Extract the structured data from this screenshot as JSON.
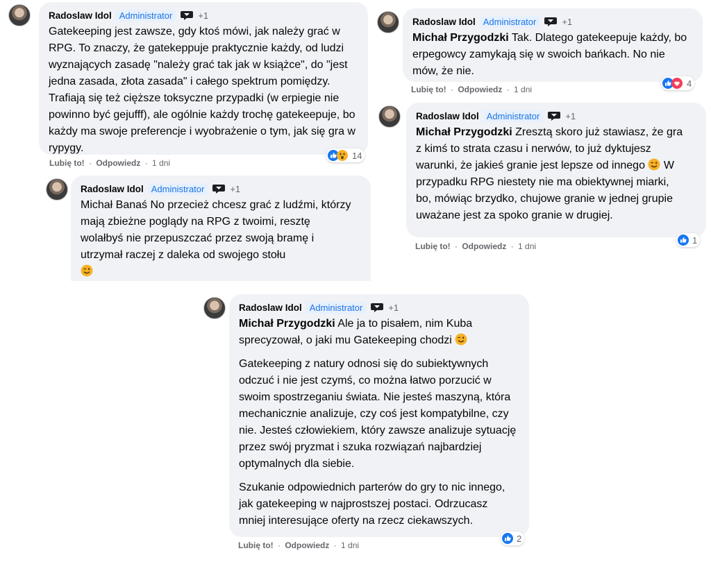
{
  "common": {
    "author": "Radoslaw Idol",
    "role": "Administrator",
    "plus": "+1",
    "like": "Lubię to!",
    "reply": "Odpowiedz",
    "dot": "·",
    "time": "1 dni"
  },
  "c1": {
    "text": "Gatekeeping jest zawsze, gdy ktoś mówi, jak należy grać w RPG. To znaczy, że gatekeppuje praktycznie każdy, od ludzi wyznających zasadę \"należy grać tak jak w książce\", do \"jest jedna zasada, złota zasada\" i całego spektrum pomiędzy. Trafiają się też cięższe toksyczne przypadki (w erpiegie nie powinno być gejufff), ale ogólnie każdy trochę gatekeepuje, bo każdy ma swoje preferencje i wyobrażenie o tym, jak się gra w rypygy.",
    "reaction_count": "14",
    "reactions": [
      "like-icon",
      "wow-icon"
    ]
  },
  "c2": {
    "text": "Michał Banaś No przecież chcesz grać z ludźmi, którzy mają zbieżne poglądy na RPG z twoimi, resztę wolałbyś nie przepuszczać przez swoją bramę i utrzymał raczej z daleka od swojego stołu"
  },
  "c3": {
    "mention": "Michał Przygodzki",
    "text": "Tak. Dlatego gatekeepuje każdy, bo erpegowcy zamykają się w swoich bańkach. No nie mów, że nie.",
    "reaction_count": "4",
    "reactions": [
      "like-icon",
      "love-icon"
    ]
  },
  "c4": {
    "mention": "Michał Przygodzki",
    "text": "Zresztą skoro już stawiasz, że gra z kimś to strata czasu i nerwów, to już dyktujesz warunki, że jakieś granie jest lepsze od innego",
    "text2": "W przypadku RPG niestety nie ma obiektywnej miarki, bo, mówiąc brzydko, chujowe granie w jednej grupie uważane jest za spoko granie w drugiej.",
    "reaction_count": "1",
    "reactions": [
      "like-icon"
    ]
  },
  "c5": {
    "mention": "Michał Przygodzki",
    "text": "Ale ja to pisałem, nim Kuba sprecyzował, o jaki mu Gatekeeping chodzi",
    "p2": "Gatekeeping z natury odnosi się do subiektywnych odczuć i nie jest czymś, co można łatwo porzucić w swoim spostrzeganiu świata. Nie jesteś maszyną, która mechanicznie analizuje, czy coś jest kompatybilne, czy nie. Jesteś człowiekiem, który zawsze analizuje sytuację przez swój pryzmat i szuka rozwiązań najbardziej optymalnych dla siebie.",
    "p3": "Szukanie odpowiednich parterów do gry to nic innego, jak gatekeeping w najprostszej postaci. Odrzucasz mniej interesujące oferty na rzecz ciekawszych.",
    "reaction_count": "2",
    "reactions": [
      "like-icon"
    ]
  },
  "colors": {
    "like": "#1877f2",
    "love": "#f33e58",
    "wow": "#f7b125",
    "badge": "#1b74e4",
    "bubble": "#f0f2f5"
  }
}
